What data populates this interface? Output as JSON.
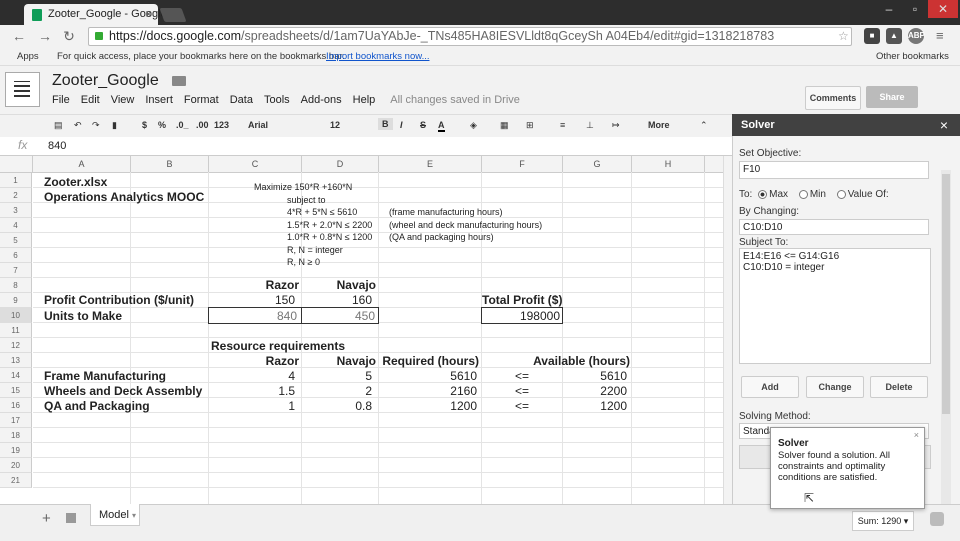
{
  "browser": {
    "tab_title": "Zooter_Google - Google",
    "tab_close": "×",
    "url_host": "https://docs.google.com",
    "url_path": "/spreadsheets/d/1am7UaYAbJe-_TNs485HA8IESVLldt8qGceySh A04Eb4/edit#gid=1318218783",
    "bookmarks_apps": "Apps",
    "bookmarks_hint": "For quick access, place your bookmarks here on the bookmarks bar.",
    "bookmarks_import": "Import bookmarks now...",
    "other_bookmarks": "Other bookmarks",
    "ext_abp": "ABP"
  },
  "docs": {
    "title": "Zooter_Google",
    "menus": [
      "File",
      "Edit",
      "View",
      "Insert",
      "Format",
      "Data",
      "Tools",
      "Add-ons",
      "Help"
    ],
    "saved_status": "All changes saved in Drive",
    "comments_label": "Comments",
    "share_label": "Share"
  },
  "format_toolbar": {
    "currency": "$",
    "percent": "%",
    "dec_less": ".0_",
    "dec_more": ".00",
    "number_format": "123",
    "font": "Arial",
    "font_size": "12",
    "bold": "B",
    "italic": "I",
    "strike": "S",
    "text_color": "A",
    "more": "More"
  },
  "formula_bar": {
    "label": "fx",
    "value": "840"
  },
  "columns": [
    "A",
    "B",
    "C",
    "D",
    "E",
    "F",
    "G",
    "H"
  ],
  "rows": [
    "1",
    "2",
    "3",
    "4",
    "5",
    "6",
    "7",
    "8",
    "9",
    "10",
    "11",
    "12",
    "13",
    "14",
    "15",
    "16",
    "17",
    "18",
    "19",
    "20",
    "21"
  ],
  "sheet": {
    "a1": "Zooter.xlsx",
    "a2": "Operations Analytics MOOC",
    "model_objective": "Maximize 150*R +160*N",
    "subject_to": "subject to",
    "constraint1": "4*R + 5*N ≤ 5610",
    "constraint1_note": "(frame manufacturing hours)",
    "constraint2": "1.5*R + 2.0*N ≤ 2200",
    "constraint2_note": "(wheel and deck manufacturing hours)",
    "constraint3": "1.0*R + 0.8*N ≤ 1200",
    "constraint3_note": "(QA and packaging hours)",
    "integer_note": "R, N = integer",
    "nonneg_note": "R, N ≥ 0",
    "razor": "Razor",
    "navajo": "Navajo",
    "profit_label": "Profit Contribution ($/unit)",
    "profit_razor": "150",
    "profit_navajo": "160",
    "total_profit_label": "Total Profit ($)",
    "units_label": "Units to Make",
    "units_razor": "840",
    "units_navajo": "450",
    "total_profit": "198000",
    "resource_title": "Resource requirements",
    "required_hdr": "Required (hours)",
    "available_hdr": "Available (hours)",
    "resources": [
      {
        "name": "Frame Manufacturing",
        "razor": "4",
        "navajo": "5",
        "required": "5610",
        "op": "<=",
        "available": "5610"
      },
      {
        "name": "Wheels and Deck Assembly",
        "razor": "1.5",
        "navajo": "2",
        "required": "2160",
        "op": "<=",
        "available": "2200"
      },
      {
        "name": "QA and Packaging",
        "razor": "1",
        "navajo": "0.8",
        "required": "1200",
        "op": "<=",
        "available": "1200"
      }
    ]
  },
  "sheets_bar": {
    "add": "+",
    "tab": "Model",
    "sum": "Sum: 1290"
  },
  "solver": {
    "title": "Solver",
    "close": "×",
    "set_objective_label": "Set Objective:",
    "objective_cell": "F10",
    "to_label": "To:",
    "max_label": "Max",
    "min_label": "Min",
    "value_of_label": "Value Of:",
    "by_changing_label": "By Changing:",
    "changing_cells": "C10:D10",
    "subject_to_label": "Subject To:",
    "constraints": [
      "E14:E16 <= G14:G16",
      "C10:D10 = integer"
    ],
    "add_label": "Add",
    "change_label": "Change",
    "delete_label": "Delete",
    "solving_method_label": "Solving Method:",
    "solving_method_value": "Standa",
    "popup_title": "Solver",
    "popup_message": "Solver found a solution. All constraints and optimality conditions are satisfied.",
    "popup_close": "×"
  }
}
